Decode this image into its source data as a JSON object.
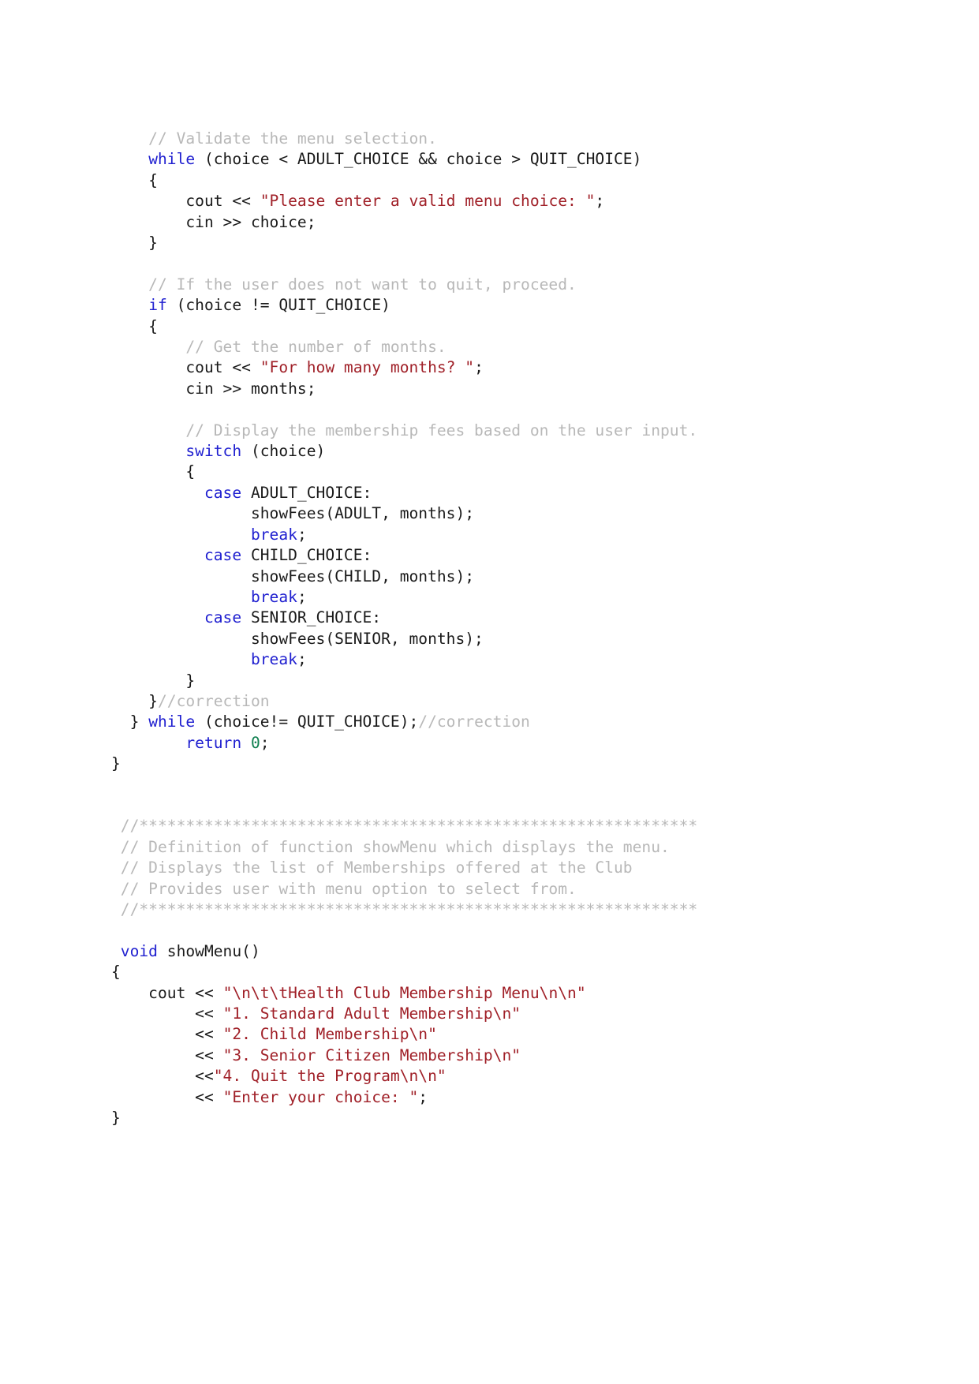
{
  "document": {
    "kind": "source-code-listing",
    "language": "C++",
    "page_background": "#ffffff",
    "colors": {
      "plain": "#1a1a1a",
      "keyword": "#2020d0",
      "string": "#a02028",
      "comment": "#b8b8b8",
      "number": "#108050"
    }
  },
  "code": {
    "lines": [
      {
        "id": "l1",
        "tokens": [
          {
            "t": "cmt",
            "s": "    // Validate the menu selection."
          }
        ]
      },
      {
        "id": "l2",
        "tokens": [
          {
            "t": "plain",
            "s": "    "
          },
          {
            "t": "kw",
            "s": "while"
          },
          {
            "t": "plain",
            "s": " (choice < ADULT_CHOICE && choice > QUIT_CHOICE)"
          }
        ]
      },
      {
        "id": "l3",
        "tokens": [
          {
            "t": "plain",
            "s": "    {"
          }
        ]
      },
      {
        "id": "l4",
        "tokens": [
          {
            "t": "plain",
            "s": "        cout << "
          },
          {
            "t": "str",
            "s": "\"Please enter a valid menu choice: \""
          },
          {
            "t": "plain",
            "s": ";"
          }
        ]
      },
      {
        "id": "l5",
        "tokens": [
          {
            "t": "plain",
            "s": "        cin >> choice;"
          }
        ]
      },
      {
        "id": "l6",
        "tokens": [
          {
            "t": "plain",
            "s": "    }"
          }
        ]
      },
      {
        "id": "l7",
        "tokens": [
          {
            "t": "plain",
            "s": ""
          }
        ]
      },
      {
        "id": "l8",
        "tokens": [
          {
            "t": "cmt",
            "s": "    // If the user does not want to quit, proceed."
          }
        ]
      },
      {
        "id": "l9",
        "tokens": [
          {
            "t": "plain",
            "s": "    "
          },
          {
            "t": "kw",
            "s": "if"
          },
          {
            "t": "plain",
            "s": " (choice != QUIT_CHOICE)"
          }
        ]
      },
      {
        "id": "l10",
        "tokens": [
          {
            "t": "plain",
            "s": "    {"
          }
        ]
      },
      {
        "id": "l11",
        "tokens": [
          {
            "t": "cmt",
            "s": "        // Get the number of months."
          }
        ]
      },
      {
        "id": "l12",
        "tokens": [
          {
            "t": "plain",
            "s": "        cout << "
          },
          {
            "t": "str",
            "s": "\"For how many months? \""
          },
          {
            "t": "plain",
            "s": ";"
          }
        ]
      },
      {
        "id": "l13",
        "tokens": [
          {
            "t": "plain",
            "s": "        cin >> months;"
          }
        ]
      },
      {
        "id": "l14",
        "tokens": [
          {
            "t": "plain",
            "s": ""
          }
        ]
      },
      {
        "id": "l15",
        "tokens": [
          {
            "t": "cmt",
            "s": "        // Display the membership fees based on the user input."
          }
        ]
      },
      {
        "id": "l16",
        "tokens": [
          {
            "t": "plain",
            "s": "        "
          },
          {
            "t": "kw",
            "s": "switch"
          },
          {
            "t": "plain",
            "s": " (choice)"
          }
        ]
      },
      {
        "id": "l17",
        "tokens": [
          {
            "t": "plain",
            "s": "        {"
          }
        ]
      },
      {
        "id": "l18",
        "tokens": [
          {
            "t": "plain",
            "s": "          "
          },
          {
            "t": "kw",
            "s": "case"
          },
          {
            "t": "plain",
            "s": " ADULT_CHOICE:"
          }
        ]
      },
      {
        "id": "l19",
        "tokens": [
          {
            "t": "plain",
            "s": "               showFees(ADULT, months);"
          }
        ]
      },
      {
        "id": "l20",
        "tokens": [
          {
            "t": "plain",
            "s": "               "
          },
          {
            "t": "kw",
            "s": "break"
          },
          {
            "t": "plain",
            "s": ";"
          }
        ]
      },
      {
        "id": "l21",
        "tokens": [
          {
            "t": "plain",
            "s": "          "
          },
          {
            "t": "kw",
            "s": "case"
          },
          {
            "t": "plain",
            "s": " CHILD_CHOICE:"
          }
        ]
      },
      {
        "id": "l22",
        "tokens": [
          {
            "t": "plain",
            "s": "               showFees(CHILD, months);"
          }
        ]
      },
      {
        "id": "l23",
        "tokens": [
          {
            "t": "plain",
            "s": "               "
          },
          {
            "t": "kw",
            "s": "break"
          },
          {
            "t": "plain",
            "s": ";"
          }
        ]
      },
      {
        "id": "l24",
        "tokens": [
          {
            "t": "plain",
            "s": "          "
          },
          {
            "t": "kw",
            "s": "case"
          },
          {
            "t": "plain",
            "s": " SENIOR_CHOICE:"
          }
        ]
      },
      {
        "id": "l25",
        "tokens": [
          {
            "t": "plain",
            "s": "               showFees(SENIOR, months);"
          }
        ]
      },
      {
        "id": "l26",
        "tokens": [
          {
            "t": "plain",
            "s": "               "
          },
          {
            "t": "kw",
            "s": "break"
          },
          {
            "t": "plain",
            "s": ";"
          }
        ]
      },
      {
        "id": "l27",
        "tokens": [
          {
            "t": "plain",
            "s": "        }"
          }
        ]
      },
      {
        "id": "l28",
        "tokens": [
          {
            "t": "plain",
            "s": "    }"
          },
          {
            "t": "cmt",
            "s": "//correction"
          }
        ]
      },
      {
        "id": "l29",
        "tokens": [
          {
            "t": "plain",
            "s": "  } "
          },
          {
            "t": "kw",
            "s": "while"
          },
          {
            "t": "plain",
            "s": " (choice!= QUIT_CHOICE);"
          },
          {
            "t": "cmt",
            "s": "//correction"
          }
        ]
      },
      {
        "id": "l30",
        "tokens": [
          {
            "t": "plain",
            "s": "        "
          },
          {
            "t": "kw",
            "s": "return"
          },
          {
            "t": "plain",
            "s": " "
          },
          {
            "t": "num",
            "s": "0"
          },
          {
            "t": "plain",
            "s": ";"
          }
        ]
      },
      {
        "id": "l31",
        "tokens": [
          {
            "t": "plain",
            "s": "}"
          }
        ]
      },
      {
        "id": "l32",
        "tokens": [
          {
            "t": "plain",
            "s": ""
          }
        ]
      },
      {
        "id": "l33",
        "tokens": [
          {
            "t": "plain",
            "s": ""
          }
        ]
      },
      {
        "id": "l34",
        "tokens": [
          {
            "t": "cmt",
            "s": " //************************************************************"
          }
        ]
      },
      {
        "id": "l35",
        "tokens": [
          {
            "t": "cmt",
            "s": " // Definition of function showMenu which displays the menu."
          }
        ]
      },
      {
        "id": "l36",
        "tokens": [
          {
            "t": "cmt",
            "s": " // Displays the list of Memberships offered at the Club"
          }
        ]
      },
      {
        "id": "l37",
        "tokens": [
          {
            "t": "cmt",
            "s": " // Provides user with menu option to select from."
          }
        ]
      },
      {
        "id": "l38",
        "tokens": [
          {
            "t": "cmt",
            "s": " //************************************************************"
          }
        ]
      },
      {
        "id": "l39",
        "tokens": [
          {
            "t": "plain",
            "s": ""
          }
        ]
      },
      {
        "id": "l40",
        "tokens": [
          {
            "t": "plain",
            "s": " "
          },
          {
            "t": "kw",
            "s": "void"
          },
          {
            "t": "plain",
            "s": " showMenu()"
          }
        ]
      },
      {
        "id": "l41",
        "tokens": [
          {
            "t": "plain",
            "s": "{"
          }
        ]
      },
      {
        "id": "l42",
        "tokens": [
          {
            "t": "plain",
            "s": "    cout << "
          },
          {
            "t": "str",
            "s": "\"\\n\\t\\tHealth Club Membership Menu\\n\\n\""
          }
        ]
      },
      {
        "id": "l43",
        "tokens": [
          {
            "t": "plain",
            "s": "         << "
          },
          {
            "t": "str",
            "s": "\"1. Standard Adult Membership\\n\""
          }
        ]
      },
      {
        "id": "l44",
        "tokens": [
          {
            "t": "plain",
            "s": "         << "
          },
          {
            "t": "str",
            "s": "\"2. Child Membership\\n\""
          }
        ]
      },
      {
        "id": "l45",
        "tokens": [
          {
            "t": "plain",
            "s": "         << "
          },
          {
            "t": "str",
            "s": "\"3. Senior Citizen Membership\\n\""
          }
        ]
      },
      {
        "id": "l46",
        "tokens": [
          {
            "t": "plain",
            "s": "         <<"
          },
          {
            "t": "str",
            "s": "\"4. Quit the Program\\n\\n\""
          }
        ]
      },
      {
        "id": "l47",
        "tokens": [
          {
            "t": "plain",
            "s": "         << "
          },
          {
            "t": "str",
            "s": "\"Enter your choice: \""
          },
          {
            "t": "plain",
            "s": ";"
          }
        ]
      },
      {
        "id": "l48",
        "tokens": [
          {
            "t": "plain",
            "s": "}"
          }
        ]
      }
    ]
  }
}
